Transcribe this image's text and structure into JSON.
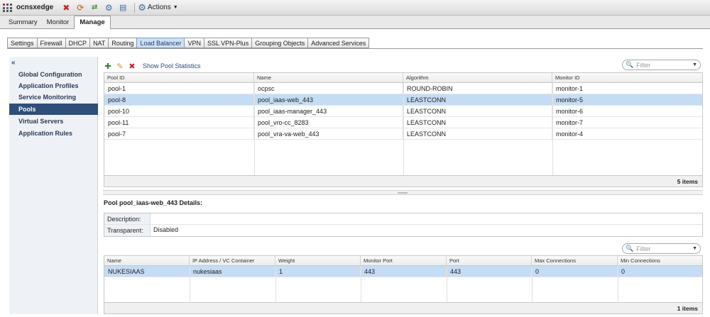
{
  "window": {
    "edge_name": "ocnsxedge",
    "actions_label": "Actions"
  },
  "main_tabs": [
    "Summary",
    "Monitor",
    "Manage"
  ],
  "sub_tabs": [
    "Settings",
    "Firewall",
    "DHCP",
    "NAT",
    "Routing",
    "Load Balancer",
    "VPN",
    "SSL VPN-Plus",
    "Grouping Objects",
    "Advanced Services"
  ],
  "sidebar": {
    "items": [
      "Global Configuration",
      "Application Profiles",
      "Service Monitoring",
      "Pools",
      "Virtual Servers",
      "Application Rules"
    ]
  },
  "toolbar": {
    "show_stats_label": "Show Pool Statistics"
  },
  "filter": {
    "placeholder": "Filter"
  },
  "pools_table": {
    "columns": [
      "Pool ID",
      "Name",
      "Algorithm",
      "Monitor ID"
    ],
    "rows": [
      [
        "pool-1",
        "ocpsc",
        "ROUND-ROBIN",
        "monitor-1"
      ],
      [
        "pool-8",
        "pool_iaas-web_443",
        "LEASTCONN",
        "monitor-5"
      ],
      [
        "pool-10",
        "pool_iaas-manager_443",
        "LEASTCONN",
        "monitor-6"
      ],
      [
        "pool-11",
        "pool_vro-cc_8283",
        "LEASTCONN",
        "monitor-7"
      ],
      [
        "pool-7",
        "pool_vra-va-web_443",
        "LEASTCONN",
        "monitor-4"
      ]
    ],
    "footer": "5 items"
  },
  "details": {
    "title": "Pool pool_iaas-web_443 Details:",
    "description_label": "Description:",
    "description_value": "",
    "transparent_label": "Transparent:",
    "transparent_value": "Disabled"
  },
  "members_table": {
    "columns": [
      "Name",
      "IP Address / VC Container",
      "Weight",
      "Monitor Port",
      "Port",
      "Max Connections",
      "Min Connections"
    ],
    "rows": [
      [
        "NUKESIAAS",
        "nukesiaas",
        "1",
        "443",
        "443",
        "0",
        "0"
      ]
    ],
    "footer": "1 items"
  }
}
